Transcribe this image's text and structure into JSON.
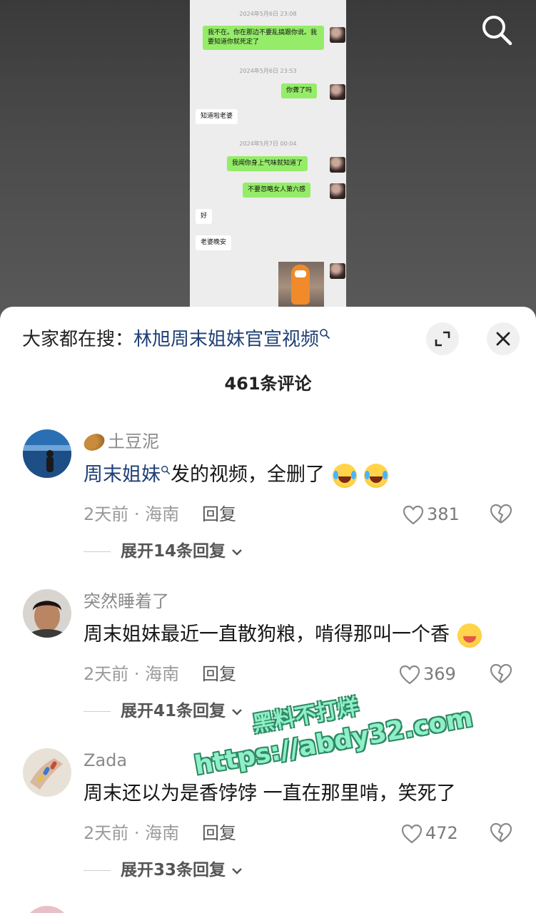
{
  "video": {
    "chat": {
      "timestamps": [
        "2024年5月6日 23:08",
        "2024年5月6日 23:53",
        "2024年5月7日 00:04"
      ],
      "messages": [
        {
          "side": "me",
          "text": "我不在。你在那边不要乱搞跟你说。我要知道你就死定了"
        },
        {
          "side": "me",
          "text": "你聋了吗"
        },
        {
          "side": "them",
          "text": "知道啦老婆"
        },
        {
          "side": "me",
          "text": "我闻你身上气味就知道了"
        },
        {
          "side": "me",
          "text": "不要忽略女人第六感"
        },
        {
          "side": "them",
          "text": "好"
        },
        {
          "side": "them",
          "text": "老婆晚安"
        }
      ]
    },
    "search_icon": "search-icon"
  },
  "sheet": {
    "search_prefix": "大家都在搜：",
    "search_term": "林旭周末姐妹官宣视频",
    "comment_count": "461条评论",
    "expand_icon": "expand-icon",
    "close_icon": "close-icon"
  },
  "comments": [
    {
      "user": "土豆泥",
      "text_link": "周末姐妹",
      "text_rest": "发的视频，全删了",
      "time_location": "2天前 · 海南",
      "reply_label": "回复",
      "likes": "381",
      "expand_label": "展开14条回复"
    },
    {
      "user": "突然睡着了",
      "text": "周末姐妹最近一直散狗粮，啃得那叫一个香",
      "time_location": "2天前 · 海南",
      "reply_label": "回复",
      "likes": "369",
      "expand_label": "展开41条回复"
    },
    {
      "user": "Zada",
      "text": "周末还以为是香饽饽 一直在那里啃，笑死了",
      "time_location": "2天前 · 海南",
      "reply_label": "回复",
      "likes": "472",
      "expand_label": "展开33条回复"
    }
  ],
  "watermark": {
    "line1": "黑料不打烊",
    "line2": "https://abdy32.com"
  },
  "colors": {
    "link": "#1f3f75",
    "bubble_me": "#95ec69",
    "watermark": "#8ff0c8"
  }
}
